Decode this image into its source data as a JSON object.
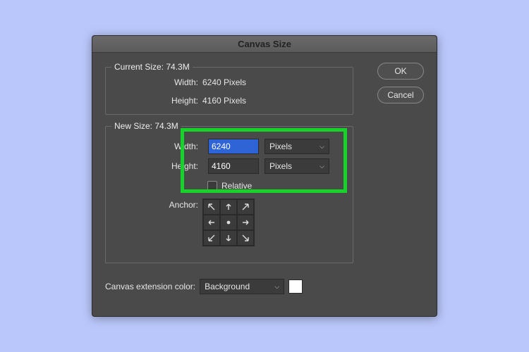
{
  "dialog": {
    "title": "Canvas Size",
    "ok_label": "OK",
    "cancel_label": "Cancel"
  },
  "current": {
    "legend": "Current Size: 74.3M",
    "width_label": "Width:",
    "width_value": "6240 Pixels",
    "height_label": "Height:",
    "height_value": "4160 Pixels"
  },
  "newsize": {
    "legend": "New Size: 74.3M",
    "width_label": "Width:",
    "width_value": "6240",
    "width_unit": "Pixels",
    "height_label": "Height:",
    "height_value": "4160",
    "height_unit": "Pixels",
    "relative_label": "Relative",
    "relative_checked": false,
    "anchor_label": "Anchor:"
  },
  "extension": {
    "label": "Canvas extension color:",
    "value": "Background",
    "swatch_color": "#ffffff"
  }
}
